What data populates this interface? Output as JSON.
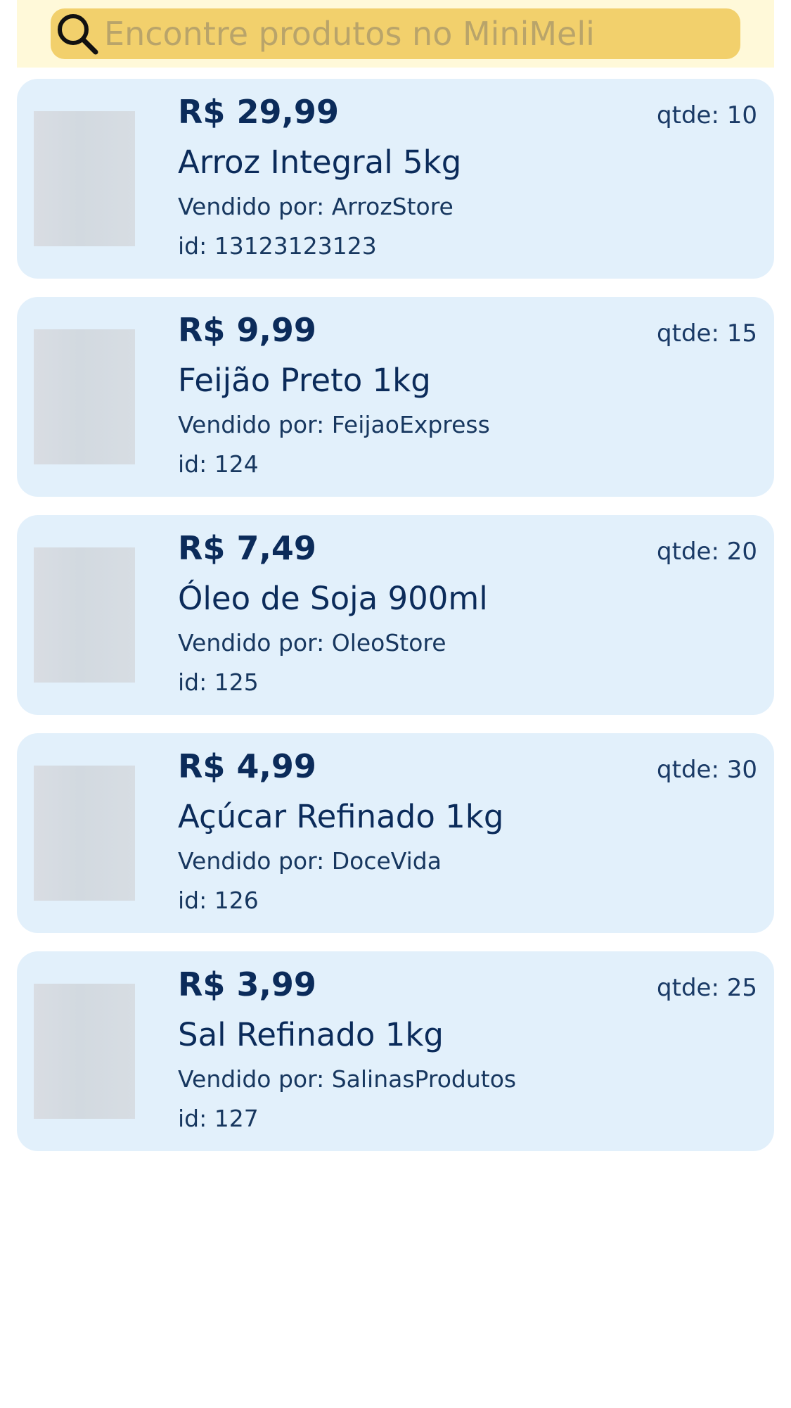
{
  "search": {
    "placeholder": "Encontre produtos no MiniMeli",
    "icon": "search-icon"
  },
  "colors": {
    "header_bg": "#fff9d9",
    "search_bg": "#f2d06c",
    "card_bg": "#e2f0fb",
    "text": "#0b2b5a"
  },
  "products": [
    {
      "price": "R$ 29,99",
      "qty_label": "qtde:",
      "qty": "10",
      "name": "Arroz Integral 5kg",
      "seller_label": "Vendido por:",
      "seller": "ArrozStore",
      "id_label": "id:",
      "id": "13123123123"
    },
    {
      "price": "R$ 9,99",
      "qty_label": "qtde:",
      "qty": "15",
      "name": "Feijão Preto 1kg",
      "seller_label": "Vendido por:",
      "seller": "FeijaoExpress",
      "id_label": "id:",
      "id": "124"
    },
    {
      "price": "R$ 7,49",
      "qty_label": "qtde:",
      "qty": "20",
      "name": "Óleo de Soja 900ml",
      "seller_label": "Vendido por:",
      "seller": "OleoStore",
      "id_label": "id:",
      "id": "125"
    },
    {
      "price": "R$ 4,99",
      "qty_label": "qtde:",
      "qty": "30",
      "name": "Açúcar Refinado 1kg",
      "seller_label": "Vendido por:",
      "seller": "DoceVida",
      "id_label": "id:",
      "id": "126"
    },
    {
      "price": "R$ 3,99",
      "qty_label": "qtde:",
      "qty": "25",
      "name": "Sal Refinado 1kg",
      "seller_label": "Vendido por:",
      "seller": "SalinasProdutos",
      "id_label": "id:",
      "id": "127"
    }
  ]
}
